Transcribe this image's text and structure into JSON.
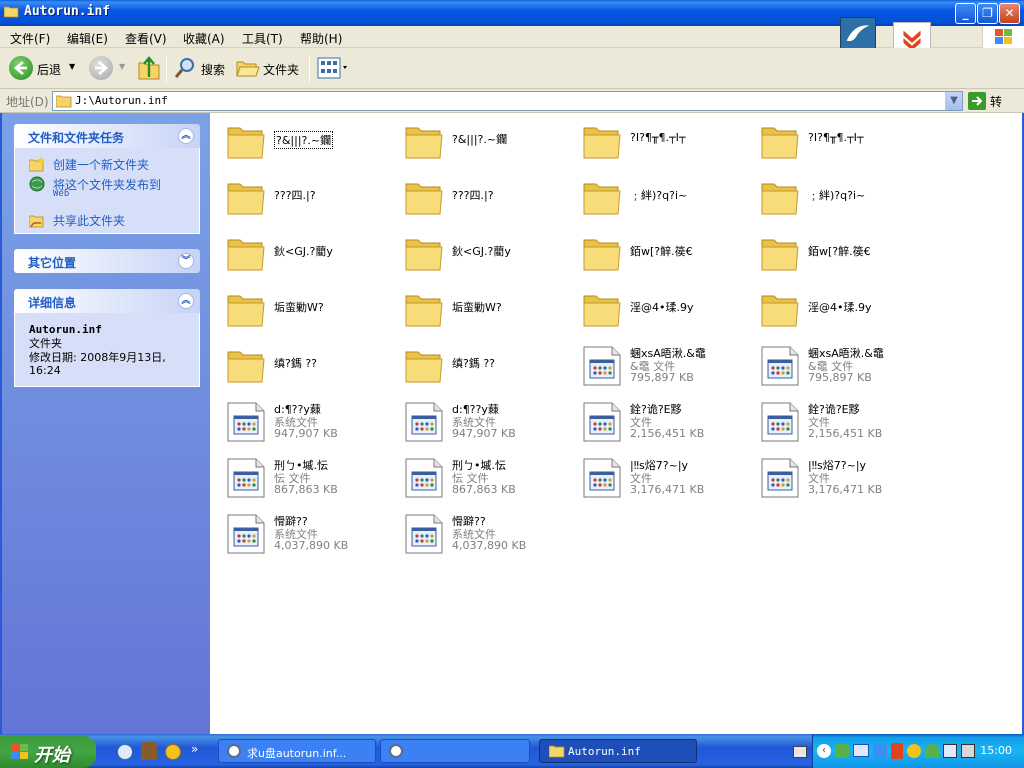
{
  "window": {
    "title": "Autorun.inf"
  },
  "menu": {
    "items": [
      "文件(F)",
      "编辑(E)",
      "查看(V)",
      "收藏(A)",
      "工具(T)",
      "帮助(H)"
    ]
  },
  "toolbar": {
    "back_label": "后退",
    "search_label": "搜索",
    "folders_label": "文件夹"
  },
  "address": {
    "label": "地址(D)",
    "value": "J:\\Autorun.inf",
    "go_label": "转到"
  },
  "left_panel": {
    "tasks_title": "文件和文件夹任务",
    "tasks": [
      {
        "label": "创建一个新文件夹",
        "sublabel": ""
      },
      {
        "label": "将这个文件夹发布到",
        "sublabel": "Web"
      },
      {
        "label": "共享此文件夹",
        "sublabel": ""
      }
    ],
    "other_title": "其它位置",
    "details_title": "详细信息",
    "details": {
      "name": "Autorun.inf",
      "type": "文件夹",
      "modified": "修改日期: 2008年9月13日, 16:24"
    }
  },
  "items": [
    {
      "kind": "folder",
      "name": "?&|||?.~鑭",
      "selected": true
    },
    {
      "kind": "folder",
      "name": "?&|||?.~鑭"
    },
    {
      "kind": "folder",
      "name": "?Ⅰ?¶╥¶.┬Ⅰ┬"
    },
    {
      "kind": "folder",
      "name": "?Ⅰ?¶╥¶.┬Ⅰ┬"
    },
    {
      "kind": "folder",
      "name": "???四.|?"
    },
    {
      "kind": "folder",
      "name": "???四.|?"
    },
    {
      "kind": "folder",
      "name": "﹔絆)?q?i~"
    },
    {
      "kind": "folder",
      "name": "﹔絆)?q?i~"
    },
    {
      "kind": "folder",
      "name": "鈥<GJ.?藺y"
    },
    {
      "kind": "folder",
      "name": "鈥<GJ.?藺y"
    },
    {
      "kind": "folder",
      "name": "銆w[?觪.篌€"
    },
    {
      "kind": "folder",
      "name": "銆w[?觪.篌€"
    },
    {
      "kind": "folder",
      "name": "垢蛮勦W?"
    },
    {
      "kind": "folder",
      "name": "垢蛮勦W?"
    },
    {
      "kind": "folder",
      "name": "淫@4•瑈.9y"
    },
    {
      "kind": "folder",
      "name": "淫@4•瑈.9y"
    },
    {
      "kind": "folder",
      "name": "缜?鎷 ??"
    },
    {
      "kind": "folder",
      "name": "缜?鎷 ??"
    },
    {
      "kind": "file",
      "name": "蜠xsA晤湫.&鼀",
      "type": "&鼀 文件",
      "size": "795,897 KB"
    },
    {
      "kind": "file",
      "name": "蜠xsA晤湫.&鼀",
      "type": "&鼀 文件",
      "size": "795,897 KB"
    },
    {
      "kind": "file",
      "name": "d:¶??y蕀",
      "type": "系统文件",
      "size": "947,907 KB"
    },
    {
      "kind": "file",
      "name": "d:¶??y蕀",
      "type": "系统文件",
      "size": "947,907 KB"
    },
    {
      "kind": "file",
      "name": "銓?诡?E黟",
      "type": "文件",
      "size": "2,156,451 KB"
    },
    {
      "kind": "file",
      "name": "銓?诡?E黟",
      "type": "文件",
      "size": "2,156,451 KB"
    },
    {
      "kind": "file",
      "name": "刑ㄅ•墄.忶",
      "type": "忶 文件",
      "size": "867,863 KB"
    },
    {
      "kind": "file",
      "name": "刑ㄅ•墄.忶",
      "type": "忶 文件",
      "size": "867,863 KB"
    },
    {
      "kind": "file",
      "name": "|‼s焀7?~|y",
      "type": "文件",
      "size": "3,176,471 KB"
    },
    {
      "kind": "file",
      "name": "|‼s焀7?~|y",
      "type": "文件",
      "size": "3,176,471 KB"
    },
    {
      "kind": "file",
      "name": "愲躃??",
      "type": "系统文件",
      "size": "4,037,890 KB"
    },
    {
      "kind": "file",
      "name": "愲躃??",
      "type": "系统文件",
      "size": "4,037,890 KB"
    }
  ],
  "taskbar": {
    "start_label": "开始",
    "tasks": [
      {
        "label": "求u盘autorun.inf..."
      },
      {
        "label": ""
      },
      {
        "label": "Autorun.inf"
      }
    ],
    "clock": "15:00"
  },
  "colors": {
    "title_blue": "#0a5fd8",
    "panel_blue": "#6375d6",
    "task_link": "#215dc6",
    "folder_yellow": "#f5d46a",
    "start_green": "#3c9a3c"
  }
}
